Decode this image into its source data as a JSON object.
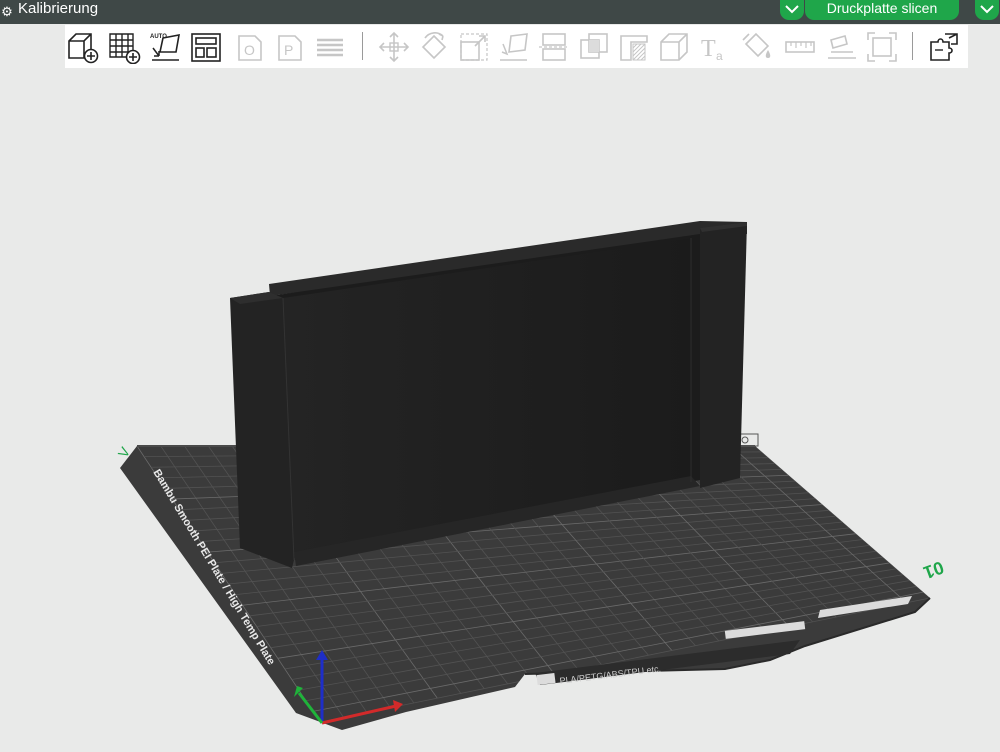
{
  "window": {
    "plate_title": "Kalibrierung",
    "gear_icon": "gear-icon"
  },
  "slice": {
    "label": "Druckplatte slicen",
    "color": "#1fa64a"
  },
  "toolbar": {
    "tools": [
      {
        "name": "add-object",
        "icon": "add-cube-icon",
        "enabled": true
      },
      {
        "name": "add-plate",
        "icon": "add-grid-icon",
        "enabled": true
      },
      {
        "name": "auto-orient",
        "icon": "auto-orient-icon",
        "enabled": true,
        "badge": "AUTO"
      },
      {
        "name": "arrange",
        "icon": "arrange-icon",
        "enabled": true
      },
      {
        "name": "split-objects",
        "icon": "split-objects-icon",
        "enabled": false,
        "badge": "O"
      },
      {
        "name": "split-parts",
        "icon": "split-parts-icon",
        "enabled": false,
        "badge": "P"
      },
      {
        "name": "layers",
        "icon": "layers-icon",
        "enabled": false
      },
      {
        "name": "move",
        "icon": "move-icon",
        "enabled": false
      },
      {
        "name": "rotate",
        "icon": "rotate-icon",
        "enabled": false
      },
      {
        "name": "scale",
        "icon": "scale-icon",
        "enabled": false
      },
      {
        "name": "lay-on-face",
        "icon": "lay-on-face-icon",
        "enabled": false
      },
      {
        "name": "cut",
        "icon": "cut-icon",
        "enabled": false
      },
      {
        "name": "boolean",
        "icon": "boolean-icon",
        "enabled": false
      },
      {
        "name": "support-paint",
        "icon": "support-paint-icon",
        "enabled": false
      },
      {
        "name": "seam-paint",
        "icon": "seam-paint-icon",
        "enabled": false
      },
      {
        "name": "color-paint",
        "icon": "color-paint-icon",
        "enabled": false
      },
      {
        "name": "text",
        "icon": "text-icon",
        "enabled": false
      },
      {
        "name": "mesh-paint",
        "icon": "paint-bucket-icon",
        "enabled": false
      },
      {
        "name": "measure",
        "icon": "ruler-icon",
        "enabled": false
      },
      {
        "name": "assembly",
        "icon": "assembly-icon",
        "enabled": false
      },
      {
        "name": "fit-view",
        "icon": "fit-view-icon",
        "enabled": false
      },
      {
        "name": "assembly-view",
        "icon": "puzzle-icon",
        "enabled": true
      }
    ]
  },
  "viewport": {
    "plate_number": "01",
    "plate_corner_mark": "V",
    "plate_label": "Bambu Smooth PEI Plate / High Temp Plate",
    "plate_materials": "PLA/PETG/ABS/TPU etc.",
    "colors": {
      "background": "#e9eae9",
      "plate": "#3b3b3b",
      "object": "#1f1f1f",
      "axis_x": "#d22a2a",
      "axis_y": "#1fb33a",
      "axis_z": "#1e2ec8",
      "accent": "#1fa64a"
    }
  }
}
